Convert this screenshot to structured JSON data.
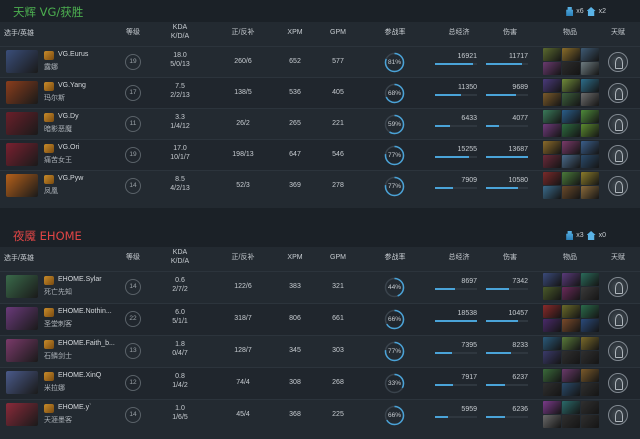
{
  "colors": {
    "radiant": "#4caf50",
    "dire": "#e04545",
    "accent": "#4aa3d8"
  },
  "header_labels": {
    "player": "选手/英雄",
    "level": "等级",
    "kda": "KDA",
    "kda_sub": "K/D/A",
    "lh": "正/反补",
    "xpm": "XPM",
    "gpm": "GPM",
    "participation": "参战率",
    "networth": "总经济",
    "damage": "伤害",
    "items": "物品",
    "talent": "天赋"
  },
  "teams": [
    {
      "title": "天辉 VG/获胜",
      "towers": "x6",
      "barracks": "x2",
      "players": [
        {
          "name": "VG.Eurus",
          "hero": "露娜",
          "level": "19",
          "kda": "18.0",
          "kda_detail": "5/0/13",
          "lh": "260/6",
          "xpm": "652",
          "gpm": "577",
          "participation": "81%",
          "part_value": 81,
          "networth": "16921",
          "nw_fill": 0.91,
          "damage": "11717",
          "dmg_fill": 0.86,
          "portrait_color": "#3a4e7a",
          "item_colors": [
            "#5b6a2f",
            "#8a6d2a",
            "#3e5a73",
            "#6a3a6f",
            "#2c2c2c",
            "#6d7b80"
          ]
        },
        {
          "name": "VG.Yang",
          "hero": "玛尔斯",
          "level": "17",
          "kda": "7.5",
          "kda_detail": "2/2/13",
          "lh": "138/5",
          "xpm": "536",
          "gpm": "405",
          "participation": "68%",
          "part_value": 68,
          "networth": "11350",
          "nw_fill": 0.61,
          "damage": "9689",
          "dmg_fill": 0.71,
          "portrait_color": "#8a3d1c",
          "item_colors": [
            "#4a3a7a",
            "#6f8a3a",
            "#2d6d8a",
            "#7a5a2a",
            "#3c5f3c",
            "#6d6d6d"
          ]
        },
        {
          "name": "VG.Dy",
          "hero": "暗影恶魔",
          "level": "11",
          "kda": "3.3",
          "kda_detail": "1/4/12",
          "lh": "26/2",
          "xpm": "265",
          "gpm": "221",
          "participation": "59%",
          "part_value": 59,
          "networth": "6433",
          "nw_fill": 0.35,
          "damage": "4077",
          "dmg_fill": 0.3,
          "portrait_color": "#6a1f2a",
          "item_colors": [
            "#3a7a5a",
            "#2a5e8a",
            "#4e8a3a",
            "#6f3a7a",
            "#2d6b3f",
            "#5b8a2f"
          ]
        },
        {
          "name": "VG.Ori",
          "hero": "痛苦女王",
          "level": "19",
          "kda": "17.0",
          "kda_detail": "10/1/7",
          "lh": "198/13",
          "xpm": "647",
          "gpm": "546",
          "participation": "77%",
          "part_value": 77,
          "networth": "15255",
          "nw_fill": 0.82,
          "damage": "13687",
          "dmg_fill": 1.0,
          "portrait_color": "#7a2030",
          "item_colors": [
            "#8a6a2a",
            "#7a3a6a",
            "#3a5e8a",
            "#6a2a3a",
            "#4a6a8a",
            "#2a4a6a"
          ]
        },
        {
          "name": "VG.Pyw",
          "hero": "凤凰",
          "level": "14",
          "kda": "8.5",
          "kda_detail": "4/2/13",
          "lh": "52/3",
          "xpm": "369",
          "gpm": "278",
          "participation": "77%",
          "part_value": 77,
          "networth": "7909",
          "nw_fill": 0.43,
          "damage": "10580",
          "dmg_fill": 0.77,
          "portrait_color": "#b5601a",
          "item_colors": [
            "#7a2a2a",
            "#4a7a3a",
            "#8a7a2a",
            "#3a6a8a",
            "#6a4a2a",
            "#8a6a3a"
          ]
        }
      ]
    },
    {
      "title": "夜魇 EHOME",
      "towers": "x3",
      "barracks": "x0",
      "players": [
        {
          "name": "EHOME.Sylar",
          "hero": "死亡先知",
          "level": "14",
          "kda": "0.6",
          "kda_detail": "2/7/2",
          "lh": "122/6",
          "xpm": "383",
          "gpm": "321",
          "participation": "44%",
          "part_value": 44,
          "networth": "8697",
          "nw_fill": 0.47,
          "damage": "7342",
          "dmg_fill": 0.54,
          "portrait_color": "#3a6a4a",
          "item_colors": [
            "#3a4a7a",
            "#5a3a7a",
            "#2a6a5a",
            "#4a5a2a",
            "#6a2a5a",
            "#3a3a3a"
          ]
        },
        {
          "name": "EHOME.Nothin...",
          "hero": "圣堂刺客",
          "level": "22",
          "kda": "6.0",
          "kda_detail": "5/1/1",
          "lh": "318/7",
          "xpm": "806",
          "gpm": "661",
          "participation": "66%",
          "part_value": 66,
          "networth": "18538",
          "nw_fill": 1.0,
          "damage": "10457",
          "dmg_fill": 0.76,
          "portrait_color": "#6a3a7a",
          "item_colors": [
            "#8a2a2a",
            "#6a6a2a",
            "#2a6a4a",
            "#4a2a6a",
            "#7a4a2a",
            "#2a4a7a"
          ]
        },
        {
          "name": "EHOME.Faith_b...",
          "hero": "石鳞剑士",
          "level": "13",
          "kda": "1.8",
          "kda_detail": "0/4/7",
          "lh": "128/7",
          "xpm": "345",
          "gpm": "303",
          "participation": "77%",
          "part_value": 77,
          "networth": "7395",
          "nw_fill": 0.4,
          "damage": "8233",
          "dmg_fill": 0.6,
          "portrait_color": "#7a3a6a",
          "item_colors": [
            "#2a5a7a",
            "#5a7a3a",
            "#7a6a2a",
            "#3a3a6a",
            "#2f2f2f",
            "#2f2f2f"
          ]
        },
        {
          "name": "EHOME.XinQ",
          "hero": "米拉娜",
          "level": "12",
          "kda": "0.8",
          "kda_detail": "1/4/2",
          "lh": "74/4",
          "xpm": "308",
          "gpm": "268",
          "participation": "33%",
          "part_value": 33,
          "networth": "7917",
          "nw_fill": 0.43,
          "damage": "6237",
          "dmg_fill": 0.46,
          "portrait_color": "#4a5a8a",
          "item_colors": [
            "#3a6a3a",
            "#6a3a6a",
            "#7a5a2a",
            "#2f2f2f",
            "#2a4a6a",
            "#2f2f2f"
          ]
        },
        {
          "name": "EHOME.y`",
          "hero": "天涯墨客",
          "level": "14",
          "kda": "1.0",
          "kda_detail": "1/6/5",
          "lh": "45/4",
          "xpm": "368",
          "gpm": "225",
          "participation": "66%",
          "part_value": 66,
          "networth": "5959",
          "nw_fill": 0.32,
          "damage": "6236",
          "dmg_fill": 0.46,
          "portrait_color": "#8a2a3a",
          "item_colors": [
            "#7a3a8a",
            "#2a6a6a",
            "#2f2f2f",
            "#6a6a6a",
            "#2f2f2f",
            "#2f2f2f"
          ]
        }
      ]
    }
  ]
}
